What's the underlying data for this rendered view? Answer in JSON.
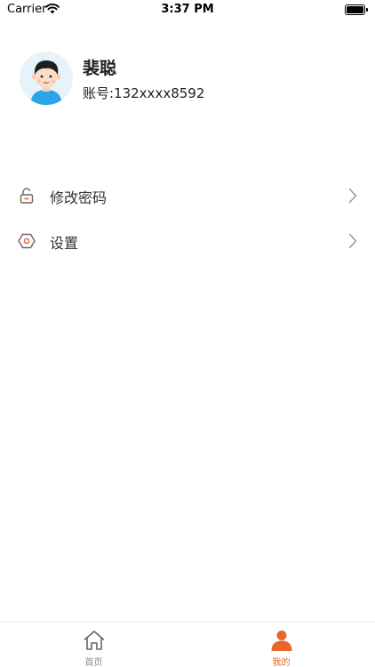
{
  "status_bar": {
    "carrier": "Carrier",
    "time": "3:37 PM",
    "wifi_icon": "wifi-icon",
    "battery_icon": "battery-full-icon"
  },
  "profile": {
    "avatar_icon": "user-avatar",
    "name": "裴聪",
    "account": "账号:132xxxx8592"
  },
  "menu": [
    {
      "label": "修改密码",
      "icon": "lock-icon"
    },
    {
      "label": "设置",
      "icon": "settings-hexagon-icon"
    }
  ],
  "tab_bar": {
    "tabs": [
      {
        "label": "首页",
        "icon": "home-icon",
        "active": false
      },
      {
        "label": "我的",
        "icon": "person-icon",
        "active": true
      }
    ],
    "active_color": "#e8652b",
    "inactive_color": "#888888"
  }
}
